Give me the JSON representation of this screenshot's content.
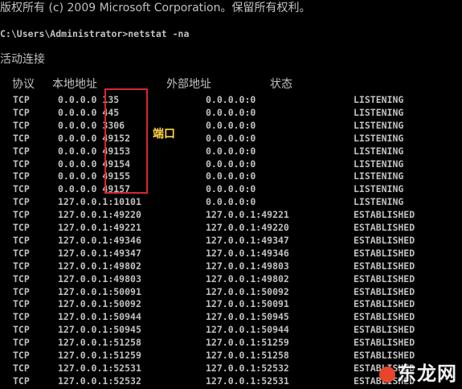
{
  "console": {
    "copyright": "版权所有 (c) 2009 Microsoft Corporation。保留所有权利。",
    "prompt": "C:\\Users\\Administrator>netstat -na",
    "section_title": "活动连接",
    "headers": {
      "protocol": "协议",
      "local": "本地地址",
      "foreign": "外部地址",
      "state": "状态"
    },
    "rows": [
      {
        "proto": "TCP",
        "local_ip": "0.0.0.0",
        "local_port": "135",
        "foreign": "0.0.0.0:0",
        "state": "LISTENING"
      },
      {
        "proto": "TCP",
        "local_ip": "0.0.0.0",
        "local_port": "445",
        "foreign": "0.0.0.0:0",
        "state": "LISTENING"
      },
      {
        "proto": "TCP",
        "local_ip": "0.0.0.0",
        "local_port": "3306",
        "foreign": "0.0.0.0:0",
        "state": "LISTENING"
      },
      {
        "proto": "TCP",
        "local_ip": "0.0.0.0",
        "local_port": "49152",
        "foreign": "0.0.0.0:0",
        "state": "LISTENING"
      },
      {
        "proto": "TCP",
        "local_ip": "0.0.0.0",
        "local_port": "49153",
        "foreign": "0.0.0.0:0",
        "state": "LISTENING"
      },
      {
        "proto": "TCP",
        "local_ip": "0.0.0.0",
        "local_port": "49154",
        "foreign": "0.0.0.0:0",
        "state": "LISTENING"
      },
      {
        "proto": "TCP",
        "local_ip": "0.0.0.0",
        "local_port": "49155",
        "foreign": "0.0.0.0:0",
        "state": "LISTENING"
      },
      {
        "proto": "TCP",
        "local_ip": "0.0.0.0",
        "local_port": "49157",
        "foreign": "0.0.0.0:0",
        "state": "LISTENING"
      },
      {
        "proto": "TCP",
        "local_ip": "127.0.0.1",
        "local_port": "10101",
        "foreign": "0.0.0.0:0",
        "state": "LISTENING"
      },
      {
        "proto": "TCP",
        "local_ip": "127.0.0.1",
        "local_port": "49220",
        "foreign": "127.0.0.1:49221",
        "state": "ESTABLISHED"
      },
      {
        "proto": "TCP",
        "local_ip": "127.0.0.1",
        "local_port": "49221",
        "foreign": "127.0.0.1:49220",
        "state": "ESTABLISHED"
      },
      {
        "proto": "TCP",
        "local_ip": "127.0.0.1",
        "local_port": "49346",
        "foreign": "127.0.0.1:49347",
        "state": "ESTABLISHED"
      },
      {
        "proto": "TCP",
        "local_ip": "127.0.0.1",
        "local_port": "49347",
        "foreign": "127.0.0.1:49346",
        "state": "ESTABLISHED"
      },
      {
        "proto": "TCP",
        "local_ip": "127.0.0.1",
        "local_port": "49802",
        "foreign": "127.0.0.1:49803",
        "state": "ESTABLISHED"
      },
      {
        "proto": "TCP",
        "local_ip": "127.0.0.1",
        "local_port": "49803",
        "foreign": "127.0.0.1:49802",
        "state": "ESTABLISHED"
      },
      {
        "proto": "TCP",
        "local_ip": "127.0.0.1",
        "local_port": "50091",
        "foreign": "127.0.0.1:50092",
        "state": "ESTABLISHED"
      },
      {
        "proto": "TCP",
        "local_ip": "127.0.0.1",
        "local_port": "50092",
        "foreign": "127.0.0.1:50091",
        "state": "ESTABLISHED"
      },
      {
        "proto": "TCP",
        "local_ip": "127.0.0.1",
        "local_port": "50944",
        "foreign": "127.0.0.1:50945",
        "state": "ESTABLISHED"
      },
      {
        "proto": "TCP",
        "local_ip": "127.0.0.1",
        "local_port": "50945",
        "foreign": "127.0.0.1:50944",
        "state": "ESTABLISHED"
      },
      {
        "proto": "TCP",
        "local_ip": "127.0.0.1",
        "local_port": "51258",
        "foreign": "127.0.0.1:51259",
        "state": "ESTABLISHED"
      },
      {
        "proto": "TCP",
        "local_ip": "127.0.0.1",
        "local_port": "51259",
        "foreign": "127.0.0.1:51258",
        "state": "ESTABLISHED"
      },
      {
        "proto": "TCP",
        "local_ip": "127.0.0.1",
        "local_port": "52531",
        "foreign": "127.0.0.1:52532",
        "state": "ESTABLISHED"
      },
      {
        "proto": "TCP",
        "local_ip": "127.0.0.1",
        "local_port": "52532",
        "foreign": "127.0.0.1:52531",
        "state": "ESTABLISHED"
      }
    ]
  },
  "annotation": {
    "label": "端口",
    "box_color": "#d8272e",
    "label_color": "#ffd44a"
  },
  "watermark": {
    "text": "东龙网"
  }
}
